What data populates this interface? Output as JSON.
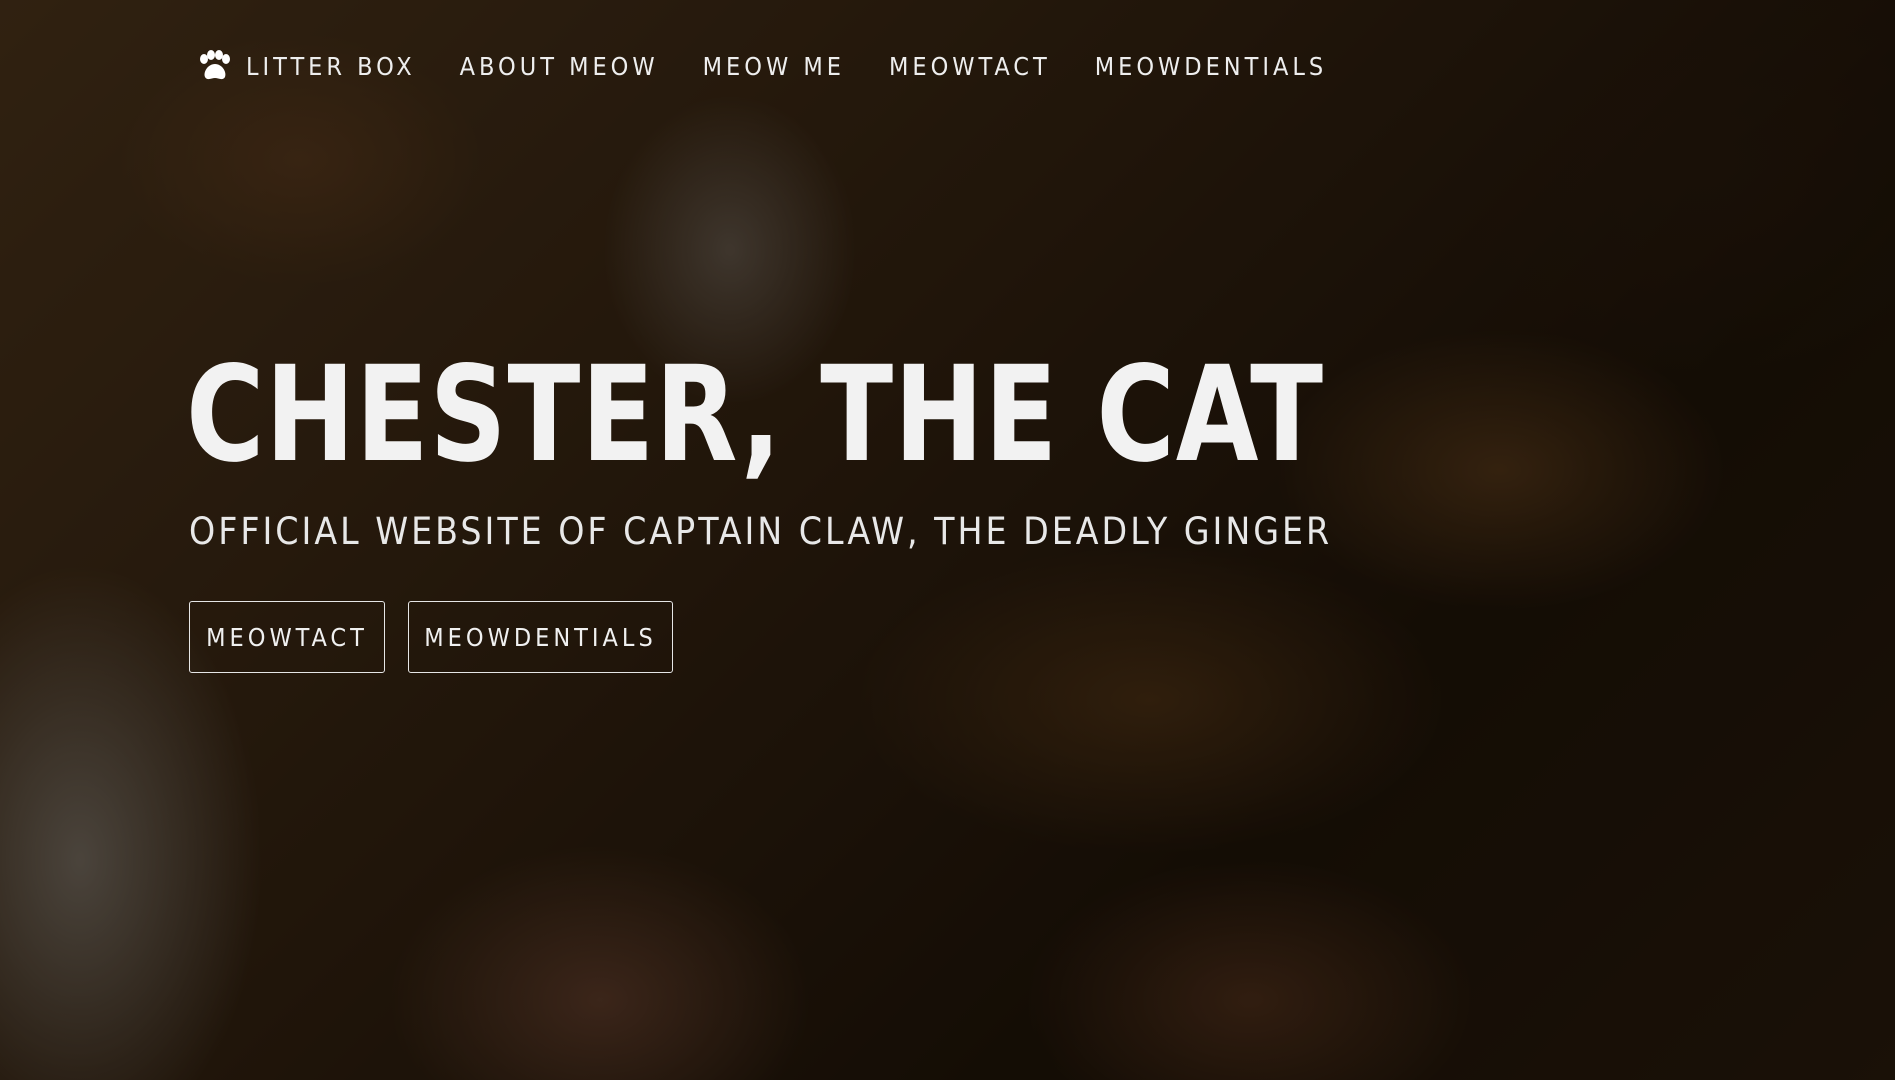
{
  "nav": {
    "brand_label": "LITTER BOX",
    "brand_icon": "paw-icon",
    "links": [
      {
        "label": "ABOUT MEOW"
      },
      {
        "label": "MEOW ME"
      },
      {
        "label": "MEOWTACT"
      },
      {
        "label": "MEOWDENTIALS"
      }
    ]
  },
  "hero": {
    "title": "CHESTER, THE CAT",
    "subtitle": "OFFICIAL WEBSITE OF CAPTAIN CLAW, THE DEADLY GINGER",
    "buttons": [
      {
        "label": "MEOWTACT"
      },
      {
        "label": "MEOWDENTIALS"
      }
    ]
  },
  "colors": {
    "text": "#f2f2f2",
    "overlay": "rgba(0,0,0,0.55)",
    "background_tone": "#4a3118"
  }
}
